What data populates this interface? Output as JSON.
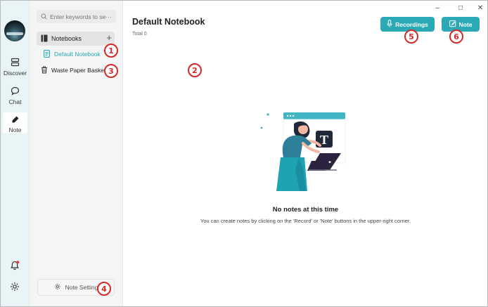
{
  "window": {
    "controls": {
      "minimize": "–",
      "maximize": "□",
      "close": "✕"
    }
  },
  "rail": {
    "items": [
      {
        "label": "Discover",
        "icon": "discover-icon"
      },
      {
        "label": "Chat",
        "icon": "chat-icon"
      },
      {
        "label": "Note",
        "icon": "note-icon",
        "active": true
      }
    ],
    "bottom": [
      {
        "icon": "bell-icon"
      },
      {
        "icon": "gear-icon"
      }
    ]
  },
  "sidebar": {
    "search_placeholder": "Enter keywords to se···",
    "notebooks_label": "Notebooks",
    "add_symbol": "+",
    "notebooks": [
      {
        "label": "Default Notebook",
        "selected": true
      }
    ],
    "waste_label": "Waste Paper Basket",
    "settings_label": "Note Setting"
  },
  "main": {
    "title": "Default Notebook",
    "total": "Total 0",
    "recordings_button": "Recordings",
    "note_button": "Note",
    "empty_title": "No notes at this time",
    "empty_desc": "You can create notes by clicking on the 'Record' or 'Note' buttons in the upper-right corner."
  },
  "markers": [
    "1",
    "2",
    "3",
    "4",
    "5",
    "6"
  ],
  "colors": {
    "accent": "#2ba9b5",
    "rail_bg": "#e8f4f6",
    "marker": "#d32a2a"
  }
}
